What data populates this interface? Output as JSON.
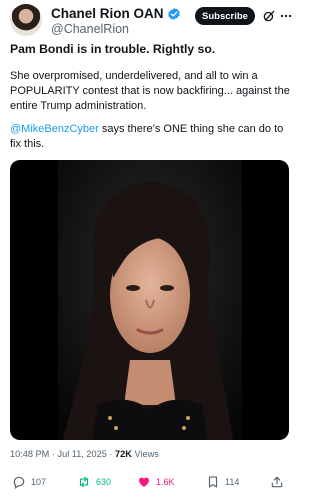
{
  "author": {
    "name": "Chanel Rion OAN",
    "handle": "@ChanelRion",
    "verified": true,
    "verified_color": "#1d9bf0"
  },
  "header": {
    "subscribe_label": "Subscribe",
    "icons": [
      "grok-icon",
      "more-icon"
    ]
  },
  "post": {
    "title": "Pam Bondi is in trouble. Rightly so.",
    "paragraph1": "She overpromised, underdelivered, and all to win a POPULARITY contest that is now backfiring... against the entire Trump administration.",
    "mention": "@MikeBenzCyber",
    "paragraph2_rest": " says there’s ONE thing she can do to fix this.",
    "media": "video"
  },
  "meta": {
    "time": "10:48 PM · Jul 11, 2025 · ",
    "views_count": "72K",
    "views_label": " Views"
  },
  "actions": {
    "replies": "107",
    "reposts": "630",
    "likes": "1.6K",
    "views": "114",
    "repost_color": "#00ba7c",
    "like_color": "#f91880"
  }
}
